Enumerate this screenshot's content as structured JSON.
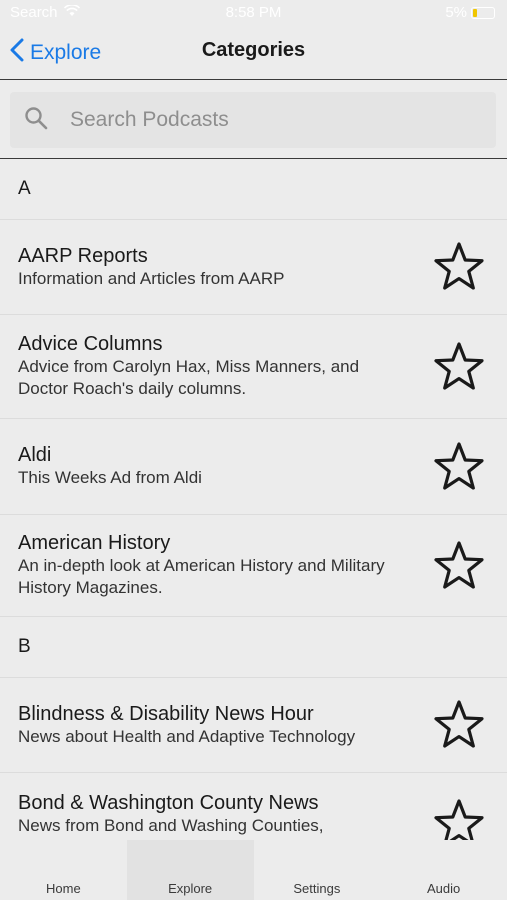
{
  "status": {
    "carrier": "Search",
    "time": "8:58 PM",
    "battery": "5%"
  },
  "nav": {
    "back_label": "Explore",
    "title": "Categories"
  },
  "search": {
    "placeholder": "Search Podcasts",
    "value": ""
  },
  "sections": [
    {
      "letter": "A",
      "items": [
        {
          "title": "AARP Reports",
          "subtitle": "Information and Articles from AARP"
        },
        {
          "title": "Advice Columns",
          "subtitle": "Advice from Carolyn Hax, Miss Manners, and Doctor Roach's daily columns."
        },
        {
          "title": "Aldi",
          "subtitle": "This Weeks Ad from Aldi"
        },
        {
          "title": "American History",
          "subtitle": "An in-depth look at American History and Military History Magazines."
        }
      ]
    },
    {
      "letter": "B",
      "items": [
        {
          "title": "Blindness & Disability News Hour",
          "subtitle": "News about Health and Adaptive Technology"
        },
        {
          "title": "Bond & Washington County News",
          "subtitle": "News from Bond and Washing Counties,"
        }
      ]
    }
  ],
  "tabs": [
    {
      "label": "Home",
      "active": false
    },
    {
      "label": "Explore",
      "active": true
    },
    {
      "label": "Settings",
      "active": false
    },
    {
      "label": "Audio",
      "active": false
    }
  ],
  "colors": {
    "accent": "#1a7ae6",
    "background": "#ececec"
  }
}
